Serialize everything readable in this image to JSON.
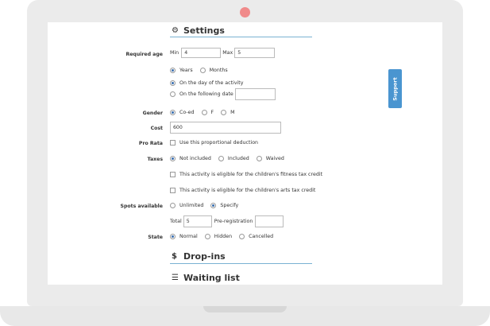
{
  "support_label": "Support",
  "settings": {
    "title": "Settings",
    "required_age": {
      "label": "Required age",
      "min_label": "Min",
      "min_value": "4",
      "max_label": "Max",
      "max_value": "5",
      "unit_years": "Years",
      "unit_months": "Months",
      "unit_selected": "Years",
      "on_day": "On the day of the activity",
      "on_following": "On the following date",
      "following_date_value": ""
    },
    "gender": {
      "label": "Gender",
      "options": [
        "Co-ed",
        "F",
        "M"
      ],
      "selected": "Co-ed"
    },
    "cost": {
      "label": "Cost",
      "value": "600"
    },
    "pro_rata": {
      "label": "Pro Rata",
      "checkbox_label": "Use this proportional deduction",
      "checked": false
    },
    "taxes": {
      "label": "Taxes",
      "options": [
        "Not included",
        "Included",
        "Waived"
      ],
      "selected": "Not included",
      "fitness_credit": "This activity is eligible for the children's fitness tax credit",
      "arts_credit": "This activity is eligible for the children's arts tax credit"
    },
    "spots": {
      "label": "Spots available",
      "options": [
        "Unlimited",
        "Specify"
      ],
      "selected": "Specify",
      "total_label": "Total",
      "total_value": "5",
      "pre_label": "Pre-registration",
      "pre_value": ""
    },
    "state": {
      "label": "State",
      "options": [
        "Normal",
        "Hidden",
        "Cancelled"
      ],
      "selected": "Normal"
    }
  },
  "dropins": {
    "title": "Drop-ins"
  },
  "waiting": {
    "title": "Waiting list"
  },
  "colors": {
    "accent": "#3a6fb0",
    "rule": "#7ab2d2",
    "support_bg": "#4a95d0",
    "camera": "#f08a8a"
  }
}
